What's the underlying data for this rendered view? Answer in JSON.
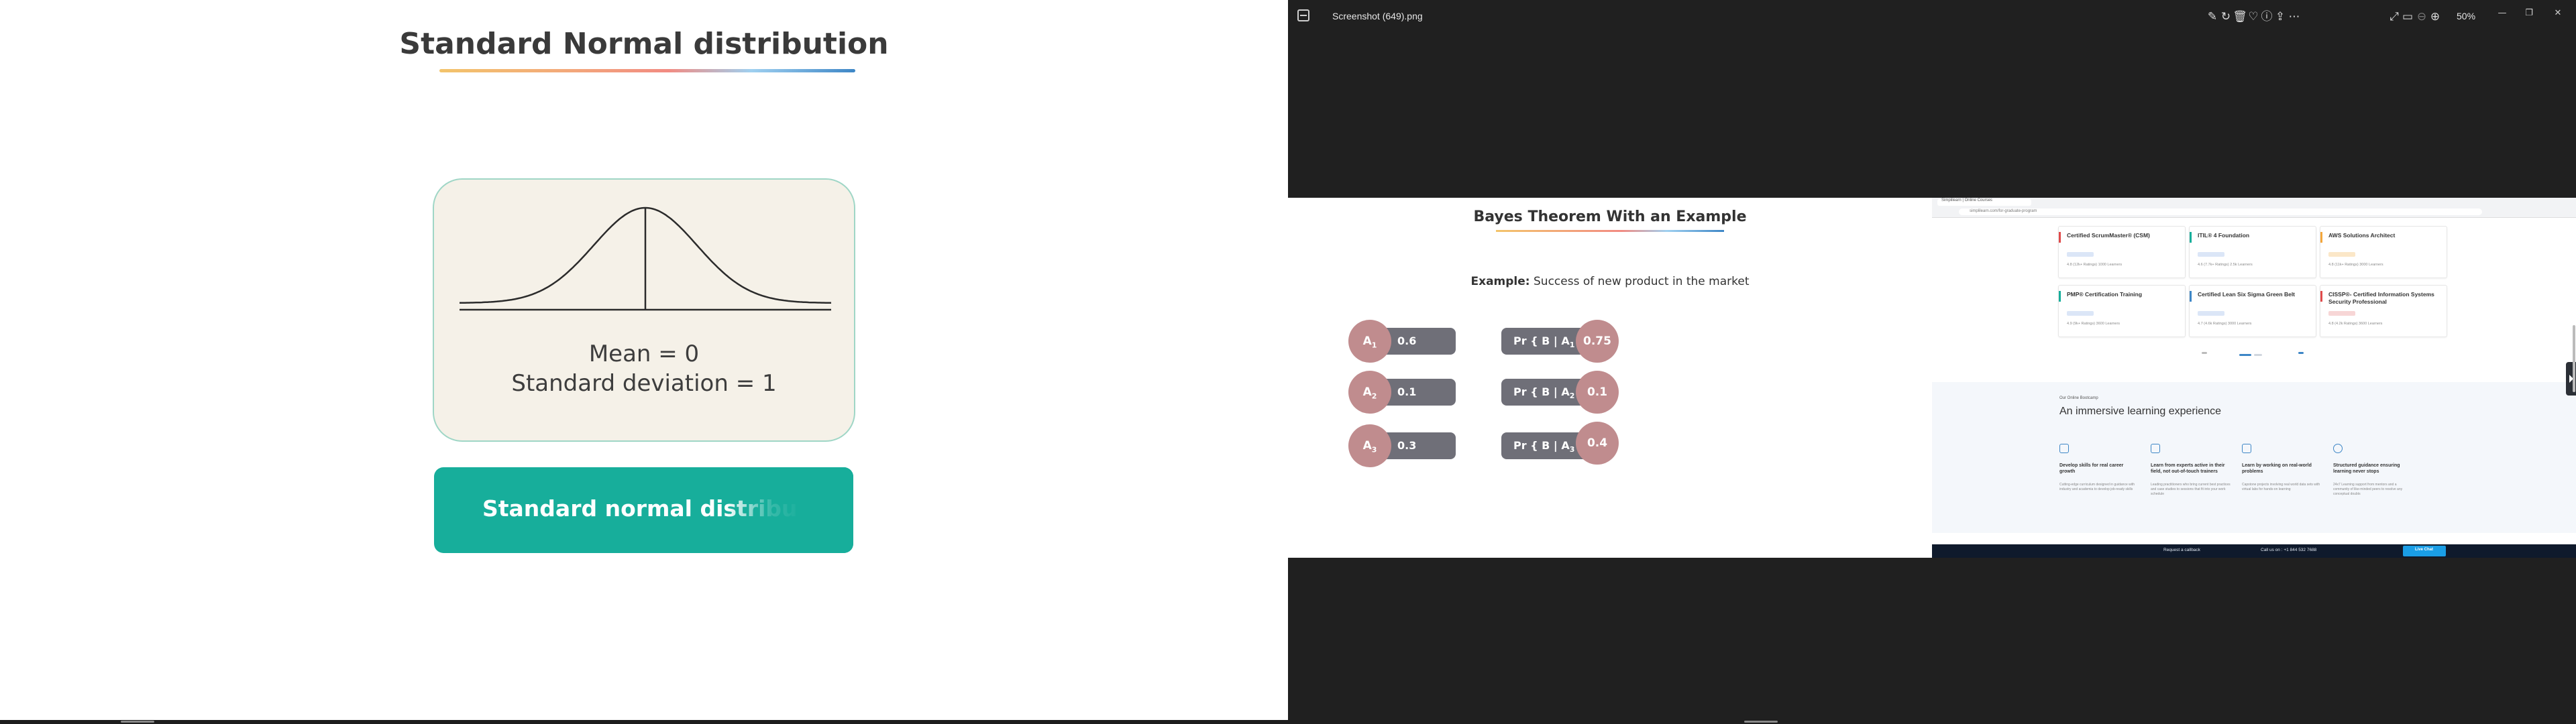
{
  "left_slide": {
    "title": "Standard Normal distribution",
    "mean_text": "Mean = 0",
    "sd_text": "Standard deviation = 1",
    "button_label": "Standard normal distribu"
  },
  "viewer": {
    "file_name": "Screenshot (649).png",
    "zoom": "50%",
    "toolbar_icons": [
      "edit-icon",
      "rotate-icon",
      "delete-icon",
      "favorite-icon",
      "info-icon",
      "share-icon",
      "more-icon"
    ],
    "view_icons": [
      "fullscreen-icon",
      "fit-icon",
      "zoom-out-icon",
      "zoom-in-icon"
    ]
  },
  "bayes": {
    "title": "Bayes Theorem With an Example",
    "example_label": "Example:",
    "example_text": " Success of new product in the market",
    "rows": [
      {
        "event": "A",
        "sub": "1",
        "prior": "0.6",
        "likelihood": "0.75"
      },
      {
        "event": "A",
        "sub": "2",
        "prior": "0.1",
        "likelihood": "0.1"
      },
      {
        "event": "A",
        "sub": "3",
        "prior": "0.3",
        "likelihood": "0.4"
      }
    ],
    "pr_prefix": "Pr { B | A",
    "pr_suffix": " }"
  },
  "website": {
    "tab_title": "Simplilearn | Online Courses",
    "url": "simplilearn.com/for-graduate-program",
    "courses": [
      {
        "title": "Certified ScrumMaster® (CSM)",
        "meta": "4.8 (12k+ Ratings)   1000 Learners",
        "color": "#e04b4b"
      },
      {
        "title": "ITIL® 4 Foundation",
        "meta": "4.6 (7.7k+ Ratings)   2.5k Learners",
        "color": "#17ae9b"
      },
      {
        "title": "AWS Solutions Architect",
        "meta": "4.8 (11k+ Ratings)   3000 Learners",
        "color": "#f3a63b"
      },
      {
        "title": "PMP® Certification Training",
        "meta": "4.9 (9k+ Ratings)   3600 Learners",
        "color": "#17ae9b"
      },
      {
        "title": "Certified Lean Six Sigma Green Belt",
        "meta": "4.7 (4.6k Ratings)   3000 Learners",
        "color": "#3d86c6"
      },
      {
        "title": "CISSP®- Certified Information Systems Security Professional",
        "meta": "4.8 (4.2k Ratings)   3600 Learners",
        "color": "#e04b4b"
      }
    ],
    "learning_sub": "Our Online Bootcamp",
    "learning_title": "An immersive learning experience",
    "features": [
      {
        "title": "Develop skills for real career growth",
        "desc": "Cutting-edge curriculum designed in guidance with industry and academia to develop job-ready skills"
      },
      {
        "title": "Learn from experts active in their field, not out-of-touch trainers",
        "desc": "Leading practitioners who bring current best practices and case studies to sessions that fit into your work schedule"
      },
      {
        "title": "Learn by working on real-world problems",
        "desc": "Capstone projects involving real world data sets with virtual labs for hands-on learning"
      },
      {
        "title": "Structured guidance ensuring learning never stops",
        "desc": "24x7 Learning support from mentors and a community of like-minded peers to resolve any conceptual doubts"
      }
    ],
    "footer": {
      "callback": "Request a callback",
      "phone": "Call us on : +1 844 532 7688",
      "chat": "Live Chat"
    }
  }
}
